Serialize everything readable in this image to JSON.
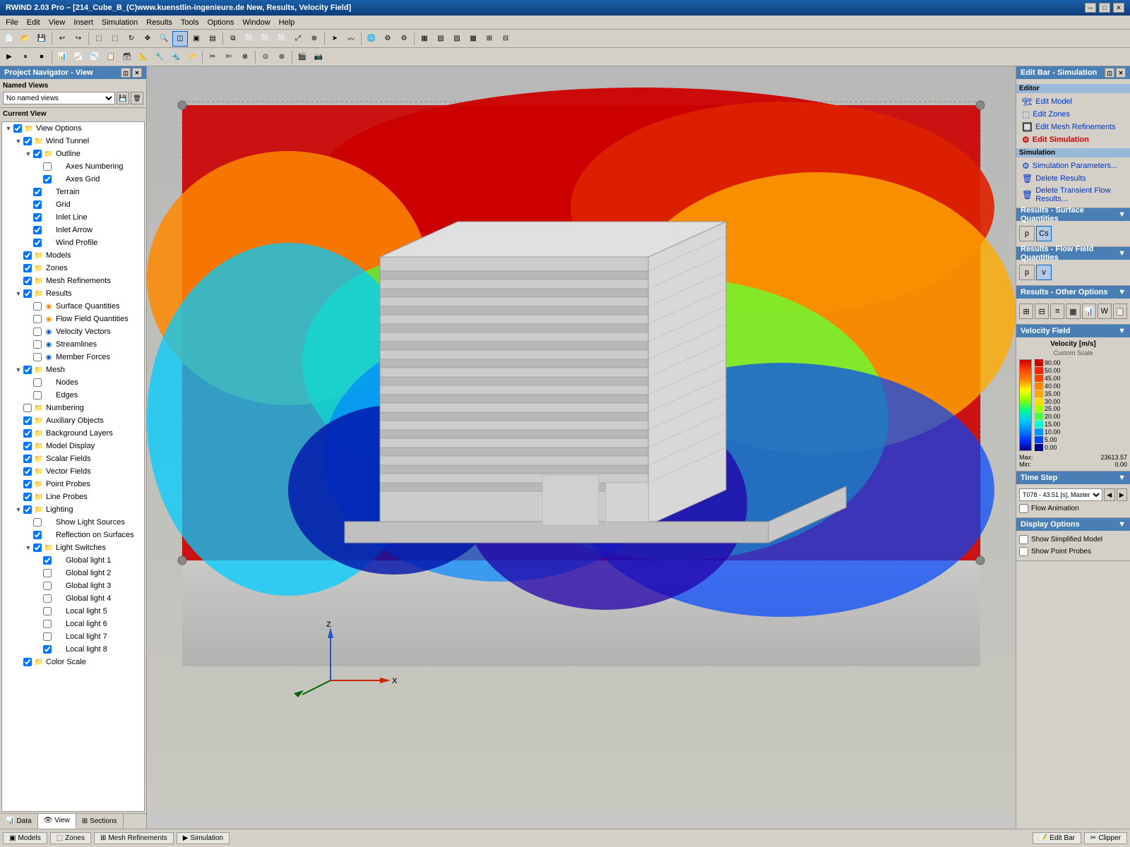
{
  "titlebar": {
    "title": "RWIND 2.03 Pro – [214_Cube_B_(C)www.kuenstlin-ingenieure.de New, Results, Velocity Field]",
    "min": "─",
    "max": "□",
    "close": "✕"
  },
  "menubar": {
    "items": [
      "File",
      "Edit",
      "View",
      "Insert",
      "Simulation",
      "Results",
      "Tools",
      "Options",
      "Window",
      "Help"
    ]
  },
  "leftpanel": {
    "title": "Project Navigator - View",
    "named_views_label": "Named Views",
    "named_views_placeholder": "No named views",
    "current_view_label": "Current View",
    "tree": [
      {
        "id": "view-options",
        "label": "View Options",
        "level": 0,
        "expanded": true,
        "icon": "☑",
        "type": "folder"
      },
      {
        "id": "wind-tunnel",
        "label": "Wind Tunnel",
        "level": 1,
        "expanded": true,
        "icon": "☑",
        "type": "folder"
      },
      {
        "id": "outline",
        "label": "Outline",
        "level": 2,
        "expanded": true,
        "icon": "☑",
        "type": "folder"
      },
      {
        "id": "axes-numbering",
        "label": "Axes Numbering",
        "level": 3,
        "icon": "☐",
        "type": "item"
      },
      {
        "id": "axes-grid",
        "label": "Axes Grid",
        "level": 3,
        "icon": "☑",
        "type": "item"
      },
      {
        "id": "terrain",
        "label": "Terrain",
        "level": 2,
        "icon": "☑",
        "type": "item"
      },
      {
        "id": "grid",
        "label": "Grid",
        "level": 2,
        "icon": "☑",
        "type": "item"
      },
      {
        "id": "inlet-line",
        "label": "Inlet Line",
        "level": 2,
        "icon": "☑",
        "type": "item"
      },
      {
        "id": "inlet-arrow",
        "label": "Inlet Arrow",
        "level": 2,
        "icon": "☑",
        "type": "item"
      },
      {
        "id": "wind-profile",
        "label": "Wind Profile",
        "level": 2,
        "icon": "☑",
        "type": "item"
      },
      {
        "id": "models",
        "label": "Models",
        "level": 1,
        "icon": "☑",
        "type": "folder"
      },
      {
        "id": "zones",
        "label": "Zones",
        "level": 1,
        "icon": "☑",
        "type": "folder"
      },
      {
        "id": "mesh-refinements",
        "label": "Mesh Refinements",
        "level": 1,
        "icon": "☑",
        "type": "folder"
      },
      {
        "id": "results",
        "label": "Results",
        "level": 1,
        "expanded": true,
        "icon": "☑",
        "type": "folder"
      },
      {
        "id": "surface-quantities",
        "label": "Surface Quantities",
        "level": 2,
        "icon": "○",
        "type": "item",
        "ico_color": "orange"
      },
      {
        "id": "flow-field-quantities",
        "label": "Flow Field Quantities",
        "level": 2,
        "icon": "○",
        "type": "item",
        "ico_color": "orange"
      },
      {
        "id": "velocity-vectors",
        "label": "Velocity Vectors",
        "level": 2,
        "icon": "○",
        "type": "item",
        "ico_color": "blue"
      },
      {
        "id": "streamlines",
        "label": "Streamlines",
        "level": 2,
        "icon": "○",
        "type": "item",
        "ico_color": "blue"
      },
      {
        "id": "member-forces",
        "label": "Member Forces",
        "level": 2,
        "icon": "○",
        "type": "item",
        "ico_color": "blue"
      },
      {
        "id": "mesh",
        "label": "Mesh",
        "level": 1,
        "expanded": true,
        "icon": "☑",
        "type": "folder"
      },
      {
        "id": "nodes",
        "label": "Nodes",
        "level": 2,
        "icon": "☐",
        "type": "item"
      },
      {
        "id": "edges",
        "label": "Edges",
        "level": 2,
        "icon": "☐",
        "type": "item"
      },
      {
        "id": "numbering",
        "label": "Numbering",
        "level": 1,
        "icon": "☐",
        "type": "folder"
      },
      {
        "id": "auxiliary-objects",
        "label": "Auxiliary Objects",
        "level": 1,
        "icon": "☑",
        "type": "folder"
      },
      {
        "id": "background-layers",
        "label": "Background Layers",
        "level": 1,
        "icon": "☑",
        "type": "folder"
      },
      {
        "id": "model-display",
        "label": "Model Display",
        "level": 1,
        "icon": "☑",
        "type": "folder"
      },
      {
        "id": "scalar-fields",
        "label": "Scalar Fields",
        "level": 1,
        "icon": "☑",
        "type": "folder"
      },
      {
        "id": "vector-fields",
        "label": "Vector Fields",
        "level": 1,
        "icon": "☑",
        "type": "folder"
      },
      {
        "id": "point-probes",
        "label": "Point Probes",
        "level": 1,
        "icon": "☑",
        "type": "folder"
      },
      {
        "id": "line-probes",
        "label": "Line Probes",
        "level": 1,
        "icon": "☑",
        "type": "folder"
      },
      {
        "id": "lighting",
        "label": "Lighting",
        "level": 1,
        "expanded": true,
        "icon": "☑",
        "type": "folder"
      },
      {
        "id": "show-light-sources",
        "label": "Show Light Sources",
        "level": 2,
        "icon": "☐",
        "type": "item"
      },
      {
        "id": "reflection-on-surfaces",
        "label": "Reflection on Surfaces",
        "level": 2,
        "icon": "☑",
        "type": "item"
      },
      {
        "id": "light-switches",
        "label": "Light Switches",
        "level": 2,
        "expanded": true,
        "icon": "☑",
        "type": "folder"
      },
      {
        "id": "global-light-1",
        "label": "Global light 1",
        "level": 3,
        "icon": "☑",
        "type": "item"
      },
      {
        "id": "global-light-2",
        "label": "Global light 2",
        "level": 3,
        "icon": "☐",
        "type": "item"
      },
      {
        "id": "global-light-3",
        "label": "Global light 3",
        "level": 3,
        "icon": "☐",
        "type": "item"
      },
      {
        "id": "global-light-4",
        "label": "Global light 4",
        "level": 3,
        "icon": "☐",
        "type": "item"
      },
      {
        "id": "local-light-5",
        "label": "Local light 5",
        "level": 3,
        "icon": "☐",
        "type": "item"
      },
      {
        "id": "local-light-6",
        "label": "Local light 6",
        "level": 3,
        "icon": "☐",
        "type": "item"
      },
      {
        "id": "local-light-7",
        "label": "Local light 7",
        "level": 3,
        "icon": "☐",
        "type": "item"
      },
      {
        "id": "local-light-8",
        "label": "Local light 8",
        "level": 3,
        "icon": "☑",
        "type": "item"
      },
      {
        "id": "color-scale",
        "label": "Color Scale",
        "level": 1,
        "icon": "☑",
        "type": "folder"
      }
    ],
    "tabs": [
      "Data",
      "View",
      "Sections"
    ]
  },
  "rightpanel": {
    "title": "Edit Bar - Simulation",
    "editor_section": "Editor",
    "editor_links": [
      "Edit Model",
      "Edit Zones",
      "Edit Mesh Refinements",
      "Edit Simulation"
    ],
    "simulation_section": "Simulation",
    "simulation_links": [
      "Simulation Parameters...",
      "Delete Results",
      "Delete Transient Flow Results..."
    ],
    "results_surface_label": "Results - Surface Quantities",
    "results_flow_label": "Results - Flow Field Quantities",
    "results_other_label": "Results - Other Options",
    "velocity_field_label": "Velocity Field",
    "velocity_unit": "Velocity [m/s]",
    "velocity_scale": "Custom Scale",
    "color_entries": [
      {
        "value": "90.00",
        "color": "#cc0000"
      },
      {
        "value": "50.00",
        "color": "#ff2200"
      },
      {
        "value": "45.00",
        "color": "#ff4400"
      },
      {
        "value": "40.00",
        "color": "#ff8800"
      },
      {
        "value": "35.00",
        "color": "#ffaa00"
      },
      {
        "value": "30.00",
        "color": "#ffdd00"
      },
      {
        "value": "25.00",
        "color": "#aaff00"
      },
      {
        "value": "20.00",
        "color": "#44ff44"
      },
      {
        "value": "15.00",
        "color": "#00ffcc"
      },
      {
        "value": "10.00",
        "color": "#0099ff"
      },
      {
        "value": "5.00",
        "color": "#0044ff"
      },
      {
        "value": "0.00",
        "color": "#000088"
      }
    ],
    "max_label": "Max:",
    "max_value": "23613.57",
    "min_label": "Min:",
    "min_value": "0.00",
    "time_step_label": "Time Step",
    "time_step_value": "T078 - 43.51 [s], Master",
    "flow_animation_label": "Flow Animation",
    "display_options_label": "Display Options",
    "show_simplified_label": "Show Simplified Model",
    "show_point_probes_label": "Show Point Probes"
  },
  "statusbar": {
    "tabs": [
      "Models",
      "Zones",
      "Mesh Refinements",
      "Simulation"
    ],
    "right_tabs": [
      "Edit Bar",
      "Clipper"
    ]
  },
  "bottompanel": {
    "left_tabs": [
      "Data",
      "View",
      "Sections"
    ]
  }
}
